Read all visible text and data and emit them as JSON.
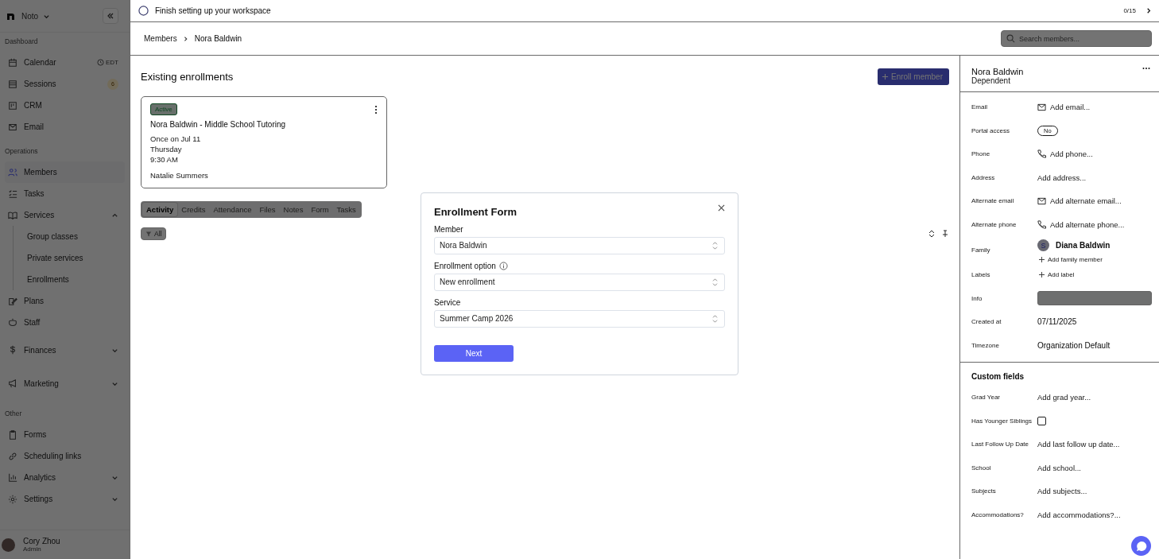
{
  "sidebar": {
    "org": "Noto",
    "sections": [
      {
        "title": "Dashboard",
        "items": [
          {
            "label": "Calendar",
            "selected": false,
            "tag": "EDT"
          },
          {
            "label": "Sessions",
            "selected": false,
            "badge": "6"
          },
          {
            "label": "CRM",
            "selected": false
          },
          {
            "label": "Email",
            "selected": false
          }
        ]
      },
      {
        "title": "Operations",
        "items": [
          {
            "label": "Members",
            "selected": true
          },
          {
            "label": "Tasks",
            "selected": false
          },
          {
            "label": "Services",
            "selected": false,
            "expanded": true,
            "children": [
              {
                "label": "Group classes",
                "selected": false
              },
              {
                "label": "Private services",
                "selected": false
              },
              {
                "label": "Enrollments",
                "selected": false
              }
            ]
          },
          {
            "label": "Plans",
            "selected": false
          },
          {
            "label": "Staff",
            "selected": false
          },
          {
            "label": "Finances",
            "selected": false,
            "expanded": false,
            "kind": "group"
          },
          {
            "label": "Marketing",
            "selected": false,
            "expanded": false,
            "kind": "group"
          }
        ]
      },
      {
        "title": "Other",
        "items": [
          {
            "label": "Forms",
            "selected": false
          },
          {
            "label": "Scheduling links",
            "selected": false
          },
          {
            "label": "Analytics",
            "selected": false,
            "expanded": false
          },
          {
            "label": "Settings",
            "selected": false,
            "expanded": false
          }
        ]
      }
    ],
    "user": {
      "name": "Cory Zhou",
      "role": "Admin"
    }
  },
  "setup_bar": {
    "text": "Finish setting up your workspace",
    "progress": "0/15"
  },
  "breadcrumb": [
    "Members",
    "Nora Baldwin"
  ],
  "search": {
    "placeholder": "Search members..."
  },
  "enrollments": {
    "title": "Existing enrollments",
    "button": "Enroll member",
    "card": {
      "status": "Active",
      "title": "Nora Baldwin - Middle School Tutoring",
      "schedule": [
        "Once on Jul 11",
        "Thursday",
        "9:30 AM"
      ],
      "staff": "Natalie Summers"
    },
    "tabs": [
      {
        "label": "Activity",
        "selected": true
      },
      {
        "label": "Credits",
        "selected": false
      },
      {
        "label": "Attendance",
        "selected": false
      },
      {
        "label": "Files",
        "selected": false
      },
      {
        "label": "Notes",
        "selected": false
      },
      {
        "label": "Form",
        "selected": false
      },
      {
        "label": "Tasks",
        "selected": false
      }
    ],
    "filter": "All"
  },
  "profile": {
    "name": "Nora Baldwin",
    "role": "Dependent",
    "fields": [
      {
        "label": "Email",
        "kind": "email",
        "placeholder": "Add email..."
      },
      {
        "label": "Portal access",
        "kind": "pill",
        "value": "No"
      },
      {
        "label": "Phone",
        "kind": "phone",
        "placeholder": "Add phone..."
      },
      {
        "label": "Address",
        "kind": "plain",
        "placeholder": "Add address..."
      },
      {
        "label": "Alternate email",
        "kind": "email",
        "placeholder": "Add alternate email..."
      },
      {
        "label": "Alternate phone",
        "kind": "phone",
        "placeholder": "Add alternate phone..."
      },
      {
        "label": "Family",
        "kind": "person",
        "value": "Diana Baldwin",
        "initial": "S",
        "add": "Add family member"
      },
      {
        "label": "Labels",
        "kind": "add",
        "value": "Add label"
      },
      {
        "label": "Info",
        "kind": "input"
      },
      {
        "label": "Created at",
        "kind": "value",
        "value": "07/11/2025"
      },
      {
        "label": "Timezone",
        "kind": "value",
        "value": "Organization Default"
      }
    ],
    "custom_title": "Custom fields",
    "custom_fields": [
      {
        "label": "Grad Year",
        "kind": "plain",
        "placeholder": "Add grad year..."
      },
      {
        "label": "Has Younger Siblings",
        "kind": "checkbox",
        "checked": false
      },
      {
        "label": "Last Follow Up Date",
        "kind": "plain",
        "placeholder": "Add last follow up date..."
      },
      {
        "label": "School",
        "kind": "plain",
        "placeholder": "Add school..."
      },
      {
        "label": "Subjects",
        "kind": "plain",
        "placeholder": "Add subjects..."
      },
      {
        "label": "Accommodations?",
        "kind": "plain",
        "placeholder": "Add accommodations?..."
      }
    ]
  },
  "modal": {
    "title": "Enrollment Form",
    "fields": [
      {
        "label": "Member",
        "value": "Nora Baldwin",
        "info": false
      },
      {
        "label": "Enrollment option",
        "value": "New enrollment",
        "info": true
      },
      {
        "label": "Service",
        "value": "Summer Camp 2026",
        "info": false
      }
    ],
    "button": "Next"
  }
}
